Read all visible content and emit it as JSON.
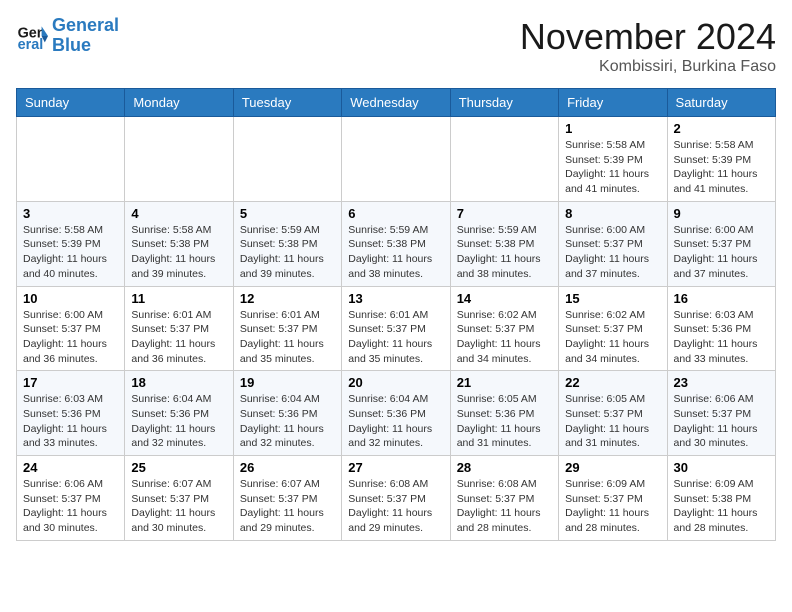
{
  "logo": {
    "line1": "General",
    "line2": "Blue"
  },
  "title": "November 2024",
  "location": "Kombissiri, Burkina Faso",
  "days_of_week": [
    "Sunday",
    "Monday",
    "Tuesday",
    "Wednesday",
    "Thursday",
    "Friday",
    "Saturday"
  ],
  "weeks": [
    [
      {
        "day": "",
        "info": ""
      },
      {
        "day": "",
        "info": ""
      },
      {
        "day": "",
        "info": ""
      },
      {
        "day": "",
        "info": ""
      },
      {
        "day": "",
        "info": ""
      },
      {
        "day": "1",
        "info": "Sunrise: 5:58 AM\nSunset: 5:39 PM\nDaylight: 11 hours\nand 41 minutes."
      },
      {
        "day": "2",
        "info": "Sunrise: 5:58 AM\nSunset: 5:39 PM\nDaylight: 11 hours\nand 41 minutes."
      }
    ],
    [
      {
        "day": "3",
        "info": "Sunrise: 5:58 AM\nSunset: 5:39 PM\nDaylight: 11 hours\nand 40 minutes."
      },
      {
        "day": "4",
        "info": "Sunrise: 5:58 AM\nSunset: 5:38 PM\nDaylight: 11 hours\nand 39 minutes."
      },
      {
        "day": "5",
        "info": "Sunrise: 5:59 AM\nSunset: 5:38 PM\nDaylight: 11 hours\nand 39 minutes."
      },
      {
        "day": "6",
        "info": "Sunrise: 5:59 AM\nSunset: 5:38 PM\nDaylight: 11 hours\nand 38 minutes."
      },
      {
        "day": "7",
        "info": "Sunrise: 5:59 AM\nSunset: 5:38 PM\nDaylight: 11 hours\nand 38 minutes."
      },
      {
        "day": "8",
        "info": "Sunrise: 6:00 AM\nSunset: 5:37 PM\nDaylight: 11 hours\nand 37 minutes."
      },
      {
        "day": "9",
        "info": "Sunrise: 6:00 AM\nSunset: 5:37 PM\nDaylight: 11 hours\nand 37 minutes."
      }
    ],
    [
      {
        "day": "10",
        "info": "Sunrise: 6:00 AM\nSunset: 5:37 PM\nDaylight: 11 hours\nand 36 minutes."
      },
      {
        "day": "11",
        "info": "Sunrise: 6:01 AM\nSunset: 5:37 PM\nDaylight: 11 hours\nand 36 minutes."
      },
      {
        "day": "12",
        "info": "Sunrise: 6:01 AM\nSunset: 5:37 PM\nDaylight: 11 hours\nand 35 minutes."
      },
      {
        "day": "13",
        "info": "Sunrise: 6:01 AM\nSunset: 5:37 PM\nDaylight: 11 hours\nand 35 minutes."
      },
      {
        "day": "14",
        "info": "Sunrise: 6:02 AM\nSunset: 5:37 PM\nDaylight: 11 hours\nand 34 minutes."
      },
      {
        "day": "15",
        "info": "Sunrise: 6:02 AM\nSunset: 5:37 PM\nDaylight: 11 hours\nand 34 minutes."
      },
      {
        "day": "16",
        "info": "Sunrise: 6:03 AM\nSunset: 5:36 PM\nDaylight: 11 hours\nand 33 minutes."
      }
    ],
    [
      {
        "day": "17",
        "info": "Sunrise: 6:03 AM\nSunset: 5:36 PM\nDaylight: 11 hours\nand 33 minutes."
      },
      {
        "day": "18",
        "info": "Sunrise: 6:04 AM\nSunset: 5:36 PM\nDaylight: 11 hours\nand 32 minutes."
      },
      {
        "day": "19",
        "info": "Sunrise: 6:04 AM\nSunset: 5:36 PM\nDaylight: 11 hours\nand 32 minutes."
      },
      {
        "day": "20",
        "info": "Sunrise: 6:04 AM\nSunset: 5:36 PM\nDaylight: 11 hours\nand 32 minutes."
      },
      {
        "day": "21",
        "info": "Sunrise: 6:05 AM\nSunset: 5:36 PM\nDaylight: 11 hours\nand 31 minutes."
      },
      {
        "day": "22",
        "info": "Sunrise: 6:05 AM\nSunset: 5:37 PM\nDaylight: 11 hours\nand 31 minutes."
      },
      {
        "day": "23",
        "info": "Sunrise: 6:06 AM\nSunset: 5:37 PM\nDaylight: 11 hours\nand 30 minutes."
      }
    ],
    [
      {
        "day": "24",
        "info": "Sunrise: 6:06 AM\nSunset: 5:37 PM\nDaylight: 11 hours\nand 30 minutes."
      },
      {
        "day": "25",
        "info": "Sunrise: 6:07 AM\nSunset: 5:37 PM\nDaylight: 11 hours\nand 30 minutes."
      },
      {
        "day": "26",
        "info": "Sunrise: 6:07 AM\nSunset: 5:37 PM\nDaylight: 11 hours\nand 29 minutes."
      },
      {
        "day": "27",
        "info": "Sunrise: 6:08 AM\nSunset: 5:37 PM\nDaylight: 11 hours\nand 29 minutes."
      },
      {
        "day": "28",
        "info": "Sunrise: 6:08 AM\nSunset: 5:37 PM\nDaylight: 11 hours\nand 28 minutes."
      },
      {
        "day": "29",
        "info": "Sunrise: 6:09 AM\nSunset: 5:37 PM\nDaylight: 11 hours\nand 28 minutes."
      },
      {
        "day": "30",
        "info": "Sunrise: 6:09 AM\nSunset: 5:38 PM\nDaylight: 11 hours\nand 28 minutes."
      }
    ]
  ]
}
